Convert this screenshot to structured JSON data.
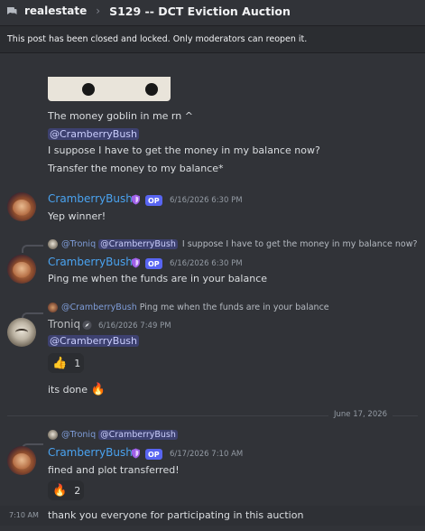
{
  "header": {
    "server": "realestate",
    "separator": "›",
    "thread_title": "S129 -- DCT Eviction Auction"
  },
  "banner": {
    "text": "This post has been closed and locked. Only moderators can reopen it."
  },
  "messages": {
    "m0": {
      "line1": "The money goblin in me rn ^",
      "mention": "@CramberryBush",
      "line3": "I suppose I have to get the money in my balance now?",
      "line4": "Transfer the money to my balance*"
    },
    "m1": {
      "author": "CramberryBush",
      "op": "OP",
      "timestamp": "6/16/2026 6:30 PM",
      "text": "Yep winner!"
    },
    "m2": {
      "reply_author": "@Troniq",
      "reply_mention": "@CramberryBush",
      "reply_text": "I suppose I have to get the money in my balance now?",
      "author": "CramberryBush",
      "op": "OP",
      "timestamp": "6/16/2026 6:30 PM",
      "text": "Ping me when the funds are in your balance"
    },
    "m3": {
      "reply_author": "@CramberryBush",
      "reply_text": "Ping me when the funds are in your balance",
      "author": "Troniq",
      "timestamp": "6/16/2026 7:49 PM",
      "mention": "@CramberryBush",
      "reaction_emoji": "👍",
      "reaction_count": "1",
      "text2": "its done",
      "text2_emoji": "🔥"
    },
    "date_divider": "June 17, 2026",
    "m4": {
      "reply_author": "@Troniq",
      "reply_mention": "@CramberryBush",
      "author": "CramberryBush",
      "op": "OP",
      "timestamp": "6/17/2026 7:10 AM",
      "text": "fined and plot transferred!",
      "reaction_emoji": "🔥",
      "reaction_count": "2"
    },
    "m5": {
      "hover_time": "7:10 AM",
      "text": "thank you everyone for participating in this auction"
    }
  },
  "colors": {
    "background": "#313338",
    "username_blue": "#4aa3f0",
    "op_badge": "#5865f2",
    "mention_bg": "#3c4270"
  },
  "icons": [
    "forum-icon",
    "shield-role-icon",
    "bot-compass-icon"
  ]
}
